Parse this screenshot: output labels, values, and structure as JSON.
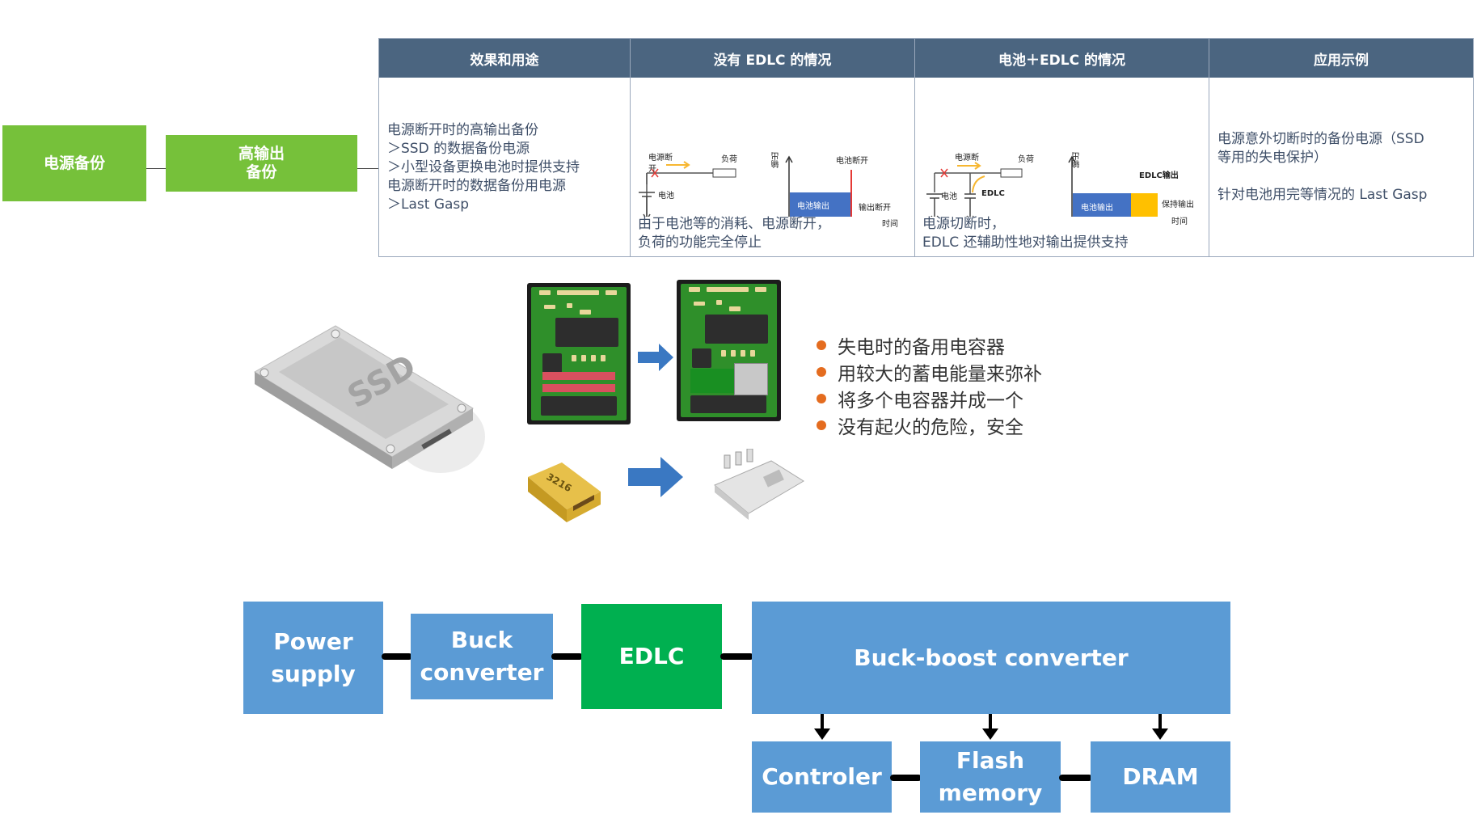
{
  "top_flow": {
    "box1": "电源备份",
    "box2_line1": "高输出",
    "box2_line2": "备份"
  },
  "table": {
    "headers": [
      "效果和用途",
      "没有 EDLC 的情况",
      "电池＋EDLC 的情况",
      "应用示例"
    ],
    "col1_lines": "电源断开时的高输出备份\n＞SSD 的数据备份电源\n＞小型设备更换电池时提供支持\n电源断开时的数据备份用电源\n＞Last Gasp",
    "col2": {
      "circuit": {
        "power_off": "电源断",
        "power_off_2": "开",
        "load": "负荷",
        "battery": "电池"
      },
      "graph": {
        "y_label": "输出",
        "battery_off": "电池断开",
        "battery_output": "电池输出",
        "output_off": "输出断开",
        "x_label": "时间"
      },
      "caption": "由于电池等的消耗、电源断开，\n负荷的功能完全停止"
    },
    "col3": {
      "circuit": {
        "power_off": "电源断",
        "load": "负荷",
        "battery": "电池",
        "edlc": "EDLC"
      },
      "graph": {
        "y_label": "输出",
        "edlc_output": "EDLC输出",
        "battery_output": "电池输出",
        "hold_output": "保持输出",
        "x_label": "时间"
      },
      "caption": "电源切断时，\nEDLC 还辅助性地对输出提供支持"
    },
    "col4_lines": "电源意外切断时的备份电源（SSD\n等用的失电保护）",
    "col4_line2": "针对电池用完等情况的 Last Gasp"
  },
  "middle": {
    "ssd_label": "SSD",
    "tantalum_label": "3216",
    "bullets": [
      "失电时的备用电容器",
      "用较大的蓄电能量来弥补",
      "将多个电容器并成一个",
      "没有起火的危险，安全"
    ]
  },
  "bottom_flow": {
    "power_supply": "Power\nsupply",
    "buck": "Buck\nconverter",
    "edlc": "EDLC",
    "buck_boost": "Buck-boost converter",
    "controler": "Controler",
    "flash": "Flash\nmemory",
    "dram": "DRAM"
  },
  "colors": {
    "green_box": "#76c13a",
    "table_header": "#4b6580",
    "flow_blue": "#5b9bd5",
    "flow_green": "#00b050",
    "bullet_orange": "#e46c1f",
    "battery_bar": "#4472c4",
    "edlc_bar": "#ffc000"
  }
}
